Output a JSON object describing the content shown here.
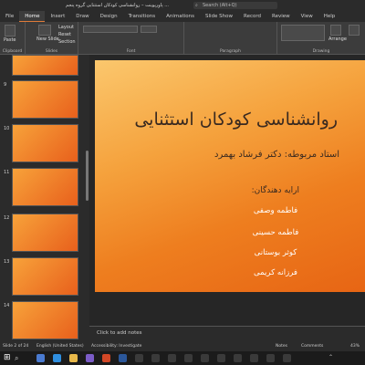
{
  "titlebar": {
    "title": "پاورپوینت – روانشناسی کودکان استثنایی گروه پنجم ...",
    "search_placeholder": "Search (Alt+Q)"
  },
  "tabs": [
    "File",
    "Home",
    "Insert",
    "Draw",
    "Design",
    "Transitions",
    "Animations",
    "Slide Show",
    "Record",
    "Review",
    "View",
    "Help"
  ],
  "ribbon": {
    "clipboard": {
      "paste": "Paste",
      "label": "Clipboard"
    },
    "slides": {
      "new_slide": "New Slide",
      "layout": "Layout",
      "reset": "Reset",
      "section": "Section",
      "label": "Slides"
    },
    "font": {
      "label": "Font"
    },
    "paragraph": {
      "label": "Paragraph"
    },
    "drawing": {
      "arrange": "Arrange",
      "label": "Drawing"
    }
  },
  "thumbnails": [
    {
      "num": "9"
    },
    {
      "num": "10"
    },
    {
      "num": "11"
    },
    {
      "num": "12"
    },
    {
      "num": "13"
    },
    {
      "num": "14"
    }
  ],
  "slide": {
    "title": "روانشناسی کودکان استثنایی",
    "advisor": "استاد مربوطه: دکتر فرشاد بهمرد",
    "presented_by": "ارایه دهندگان:",
    "members": [
      "فاطمه وصفی",
      "فاطمه حسینی",
      "کوثر بوستانی",
      "فرزانه کریمی"
    ]
  },
  "notes": {
    "placeholder": "Click to add notes"
  },
  "status": {
    "slide": "Slide 2 of 24",
    "language": "English (United States)",
    "accessibility": "Accessibility: Investigate",
    "notes": "Notes",
    "comments": "Comments",
    "zoom": "43%"
  },
  "colors": {
    "accent": "#e07b39",
    "slide_top": "#fbc76d",
    "slide_bottom": "#e76514"
  }
}
